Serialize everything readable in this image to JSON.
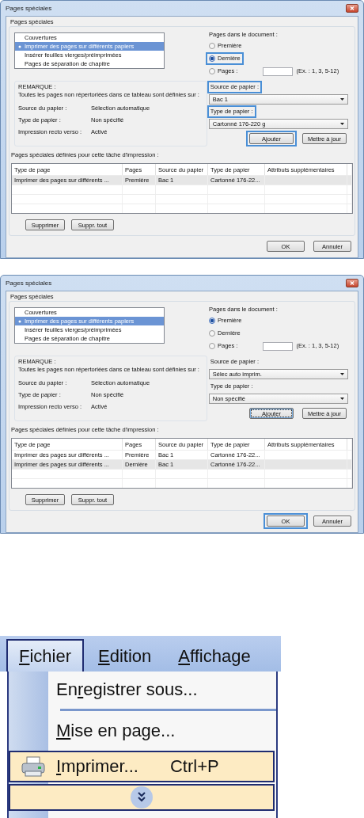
{
  "dialogs": [
    {
      "title": "Pages spéciales",
      "group_label": "Pages spéciales",
      "page_types": [
        {
          "label": "Couvertures",
          "selected": false
        },
        {
          "label": "Imprimer des pages sur différents papiers",
          "selected": true
        },
        {
          "label": "Insérer feuilles vierges/préimprimées",
          "selected": false
        },
        {
          "label": "Pages de séparation de chapitre",
          "selected": false
        }
      ],
      "pages_label": "Pages dans le document :",
      "page_options": [
        {
          "label": "Première",
          "selected": false,
          "highlighted": false
        },
        {
          "label": "Dernière",
          "selected": true,
          "highlighted": true
        },
        {
          "label": "Pages :",
          "selected": false,
          "highlighted": false
        }
      ],
      "pages_hint": "(Ex. : 1, 3, 5-12)",
      "note_title": "REMARQUE :",
      "note_text": "Toutes les pages non répertoriées dans ce tableau sont définies sur :",
      "defaults": [
        {
          "label": "Source du papier :",
          "value": "Sélection automatique"
        },
        {
          "label": "Type de papier :",
          "value": "Non spécifié"
        },
        {
          "label": "Impression recto verso :",
          "value": "Activé"
        }
      ],
      "source": {
        "label": "Source de papier :",
        "value": "Bac 1",
        "highlighted": true
      },
      "paper_type": {
        "label": "Type de papier :",
        "value": "Cartonné 176-220 g",
        "highlighted": true
      },
      "action_buttons": [
        {
          "label": "Ajouter",
          "highlighted": true,
          "focused": false
        },
        {
          "label": "Mettre à jour",
          "highlighted": false,
          "focused": false
        }
      ],
      "table_caption": "Pages spéciales définies pour cette tâche d'impression :",
      "table": {
        "columns": [
          "Type de page",
          "Pages",
          "Source du papier",
          "Type de papier",
          "Attributs supplémentaires"
        ],
        "rows": [
          {
            "cells": [
              "Imprimer des pages sur différents ...",
              "Première",
              "Bac 1",
              "Cartonné 176-22..."
            ],
            "selected": true
          }
        ]
      },
      "list_buttons": [
        "Supprimer",
        "Suppr. tout"
      ],
      "dialog_buttons": [
        {
          "label": "OK",
          "highlighted": false
        },
        {
          "label": "Annuler",
          "highlighted": false
        }
      ]
    },
    {
      "title": "Pages spéciales",
      "group_label": "Pages spéciales",
      "page_types": [
        {
          "label": "Couvertures",
          "selected": false
        },
        {
          "label": "Imprimer des pages sur différents papiers",
          "selected": true
        },
        {
          "label": "Insérer feuilles vierges/préimprimées",
          "selected": false
        },
        {
          "label": "Pages de séparation de chapitre",
          "selected": false
        }
      ],
      "pages_label": "Pages dans le document :",
      "page_options": [
        {
          "label": "Première",
          "selected": true,
          "highlighted": false
        },
        {
          "label": "Dernière",
          "selected": false,
          "highlighted": false
        },
        {
          "label": "Pages :",
          "selected": false,
          "highlighted": false
        }
      ],
      "pages_hint": "(Ex. : 1, 3, 5-12)",
      "note_title": "REMARQUE :",
      "note_text": "Toutes les pages non répertoriées dans ce tableau sont définies sur :",
      "defaults": [
        {
          "label": "Source du papier :",
          "value": "Sélection automatique"
        },
        {
          "label": "Type de papier :",
          "value": "Non spécifié"
        },
        {
          "label": "Impression recto verso :",
          "value": "Activé"
        }
      ],
      "source": {
        "label": "Source de papier :",
        "value": "Sélec auto imprim.",
        "highlighted": false
      },
      "paper_type": {
        "label": "Type de papier :",
        "value": "Non spécifié",
        "highlighted": false
      },
      "action_buttons": [
        {
          "label": "Ajouter",
          "highlighted": false,
          "focused": true
        },
        {
          "label": "Mettre à jour",
          "highlighted": false,
          "focused": false
        }
      ],
      "table_caption": "Pages spéciales définies pour cette tâche d'impression :",
      "table": {
        "columns": [
          "Type de page",
          "Pages",
          "Source du papier",
          "Type de papier",
          "Attributs supplémentaires"
        ],
        "rows": [
          {
            "cells": [
              "Imprimer des pages sur différents ...",
              "Première",
              "Bac 1",
              "Cartonné 176-22..."
            ],
            "selected": false
          },
          {
            "cells": [
              "Imprimer des pages sur différents ...",
              "Dernière",
              "Bac 1",
              "Cartonné 176-22..."
            ],
            "selected": true
          }
        ]
      },
      "list_buttons": [
        "Supprimer",
        "Suppr. tout"
      ],
      "dialog_buttons": [
        {
          "label": "OK",
          "highlighted": true
        },
        {
          "label": "Annuler",
          "highlighted": false
        }
      ]
    }
  ],
  "menu": {
    "bar": [
      {
        "key": "F",
        "post": "ichier",
        "open": true
      },
      {
        "key": "E",
        "post": "dition",
        "open": false
      },
      {
        "key": "A",
        "post": "ffichage",
        "open": false
      }
    ],
    "items": [
      {
        "kind": "item",
        "pre": "En",
        "key": "r",
        "post": "egistrer sous...",
        "highlighted": false
      },
      {
        "kind": "separator"
      },
      {
        "kind": "item",
        "key": "M",
        "post": "ise en page...",
        "highlighted": false
      },
      {
        "kind": "print_item",
        "key": "I",
        "post": "mprimer...",
        "shortcut": "Ctrl+P",
        "highlighted": true
      },
      {
        "kind": "expand",
        "highlighted": true
      }
    ]
  }
}
